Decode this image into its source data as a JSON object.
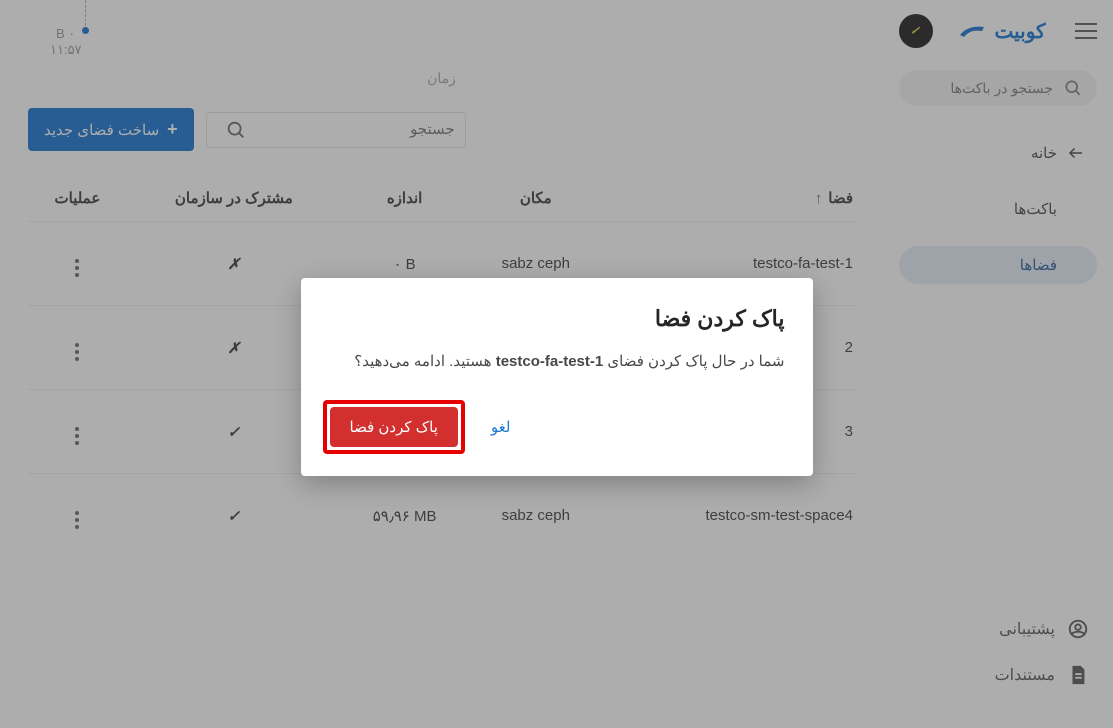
{
  "brand": "کوبیت",
  "sidebar": {
    "search_placeholder": "جستجو در باکت‌ها",
    "home": "خانه",
    "buckets": "باکت‌ها",
    "spaces": "فضاها",
    "support": "پشتیبانی",
    "docs": "مستندات"
  },
  "chart": {
    "zero_label": "۰ B",
    "time_label": "۱۱:۵۷",
    "axis_label": "زمان"
  },
  "toolbar": {
    "create_space": "ساخت فضای جدید",
    "search_placeholder": "جستجو"
  },
  "table": {
    "headers": {
      "space": "فضا",
      "location": "مکان",
      "size": "اندازه",
      "shared": "مشترک در سازمان",
      "actions": "عملیات"
    },
    "rows": [
      {
        "space": "testco-fa-test-1",
        "location": "sabz ceph",
        "size": "۰ B",
        "shared": "✗"
      },
      {
        "space": "2",
        "location": "",
        "size": "",
        "shared": "✗"
      },
      {
        "space": "3",
        "location": "",
        "size": "",
        "shared": "✓"
      },
      {
        "space": "testco-sm-test-space4",
        "location": "sabz ceph",
        "size": "۵۹٫۹۶ MB",
        "shared": "✓"
      }
    ]
  },
  "modal": {
    "title": "پاک کردن فضا",
    "body_prefix": "شما در حال پاک کردن فضای ",
    "body_bold": "testco-fa-test-1",
    "body_suffix": " هستید. ادامه می‌دهید؟",
    "cancel": "لغو",
    "confirm": "پاک کردن فضا"
  }
}
